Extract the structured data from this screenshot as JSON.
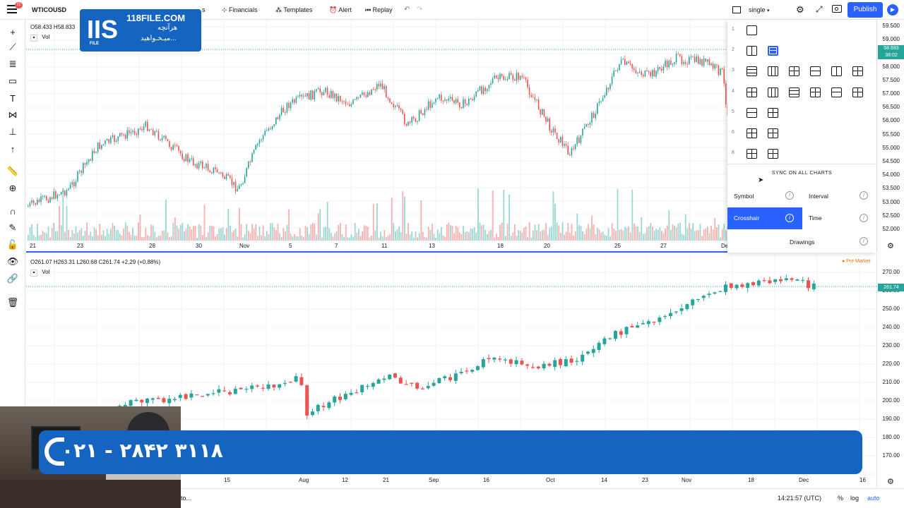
{
  "toolbar": {
    "notification_count": "11",
    "symbol": "WTICOUSD",
    "financials": "Financials",
    "financials_prefix": "s",
    "templates": "Templates",
    "alert": "Alert",
    "replay": "Replay",
    "layout_mode": "single",
    "publish": "Publish"
  },
  "logo": {
    "site": "118FILE.COM",
    "line1": "هرآنچه",
    "line2": "میـخـواهید...",
    "tag": "FILE"
  },
  "chart1": {
    "ohlc": "O58.433  H58.833",
    "vol_label": "Vol",
    "price_labels": [
      "59.500",
      "59.000",
      "58.500",
      "58.000",
      "57.500",
      "57.000",
      "56.500",
      "56.000",
      "55.500",
      "55.000",
      "54.500",
      "54.000",
      "53.500",
      "53.000",
      "52.500",
      "52.000"
    ],
    "current_price": "58.693",
    "countdown": "38:02",
    "x_labels": [
      "21",
      "23",
      "28",
      "30",
      "Nov",
      "5",
      "7",
      "11",
      "13",
      "18",
      "20",
      "25",
      "27",
      "De"
    ]
  },
  "chart2": {
    "ohlc": "O261.07  H263.31  L260.68  C261.74  +2.29 (+0.88%)",
    "vol_label": "Vol",
    "pre_market": "Pre Market",
    "price_labels": [
      "270.00",
      "260.00",
      "250.00",
      "240.00",
      "230.00",
      "220.00",
      "210.00",
      "200.00",
      "190.00",
      "180.00",
      "170.00"
    ],
    "current_price": "261.74",
    "x_labels": [
      "15",
      "Aug",
      "12",
      "21",
      "Sep",
      "16",
      "Oct",
      "14",
      "23",
      "Nov",
      "18",
      "Dec",
      "16"
    ]
  },
  "layout_panel": {
    "row_numbers": [
      "1",
      "2",
      "3",
      "4",
      "5",
      "6",
      "8"
    ],
    "sync_title": "SYNC ON ALL CHARTS",
    "symbol": "Symbol",
    "interval": "Interval",
    "crosshair": "Crosshair",
    "time": "Time",
    "drawings": "Drawings"
  },
  "banner": {
    "phone": "۰۲۱ - ۲۸۴۲ ۳۱۱۸"
  },
  "bottombar": {
    "goto": "to...",
    "time": "14:21:57 (UTC)",
    "percent": "%",
    "log": "log",
    "auto": "auto"
  },
  "colors": {
    "up": "#26a69a",
    "down": "#ef5350",
    "accent": "#2962ff",
    "brand_blue": "#1565c0"
  },
  "icons": [
    "menu-icon",
    "crosshair-icon",
    "trend-line-icon",
    "fib-icon",
    "rectangle-icon",
    "text-icon",
    "pattern-icon",
    "measure-icon",
    "arrow-icon",
    "ruler-icon",
    "zoom-icon",
    "magnet-icon",
    "lock-draw-icon",
    "lock-icon",
    "eye-icon",
    "link-icon",
    "trash-icon",
    "camera-icon",
    "fullscreen-icon",
    "gear-icon",
    "play-icon"
  ]
}
